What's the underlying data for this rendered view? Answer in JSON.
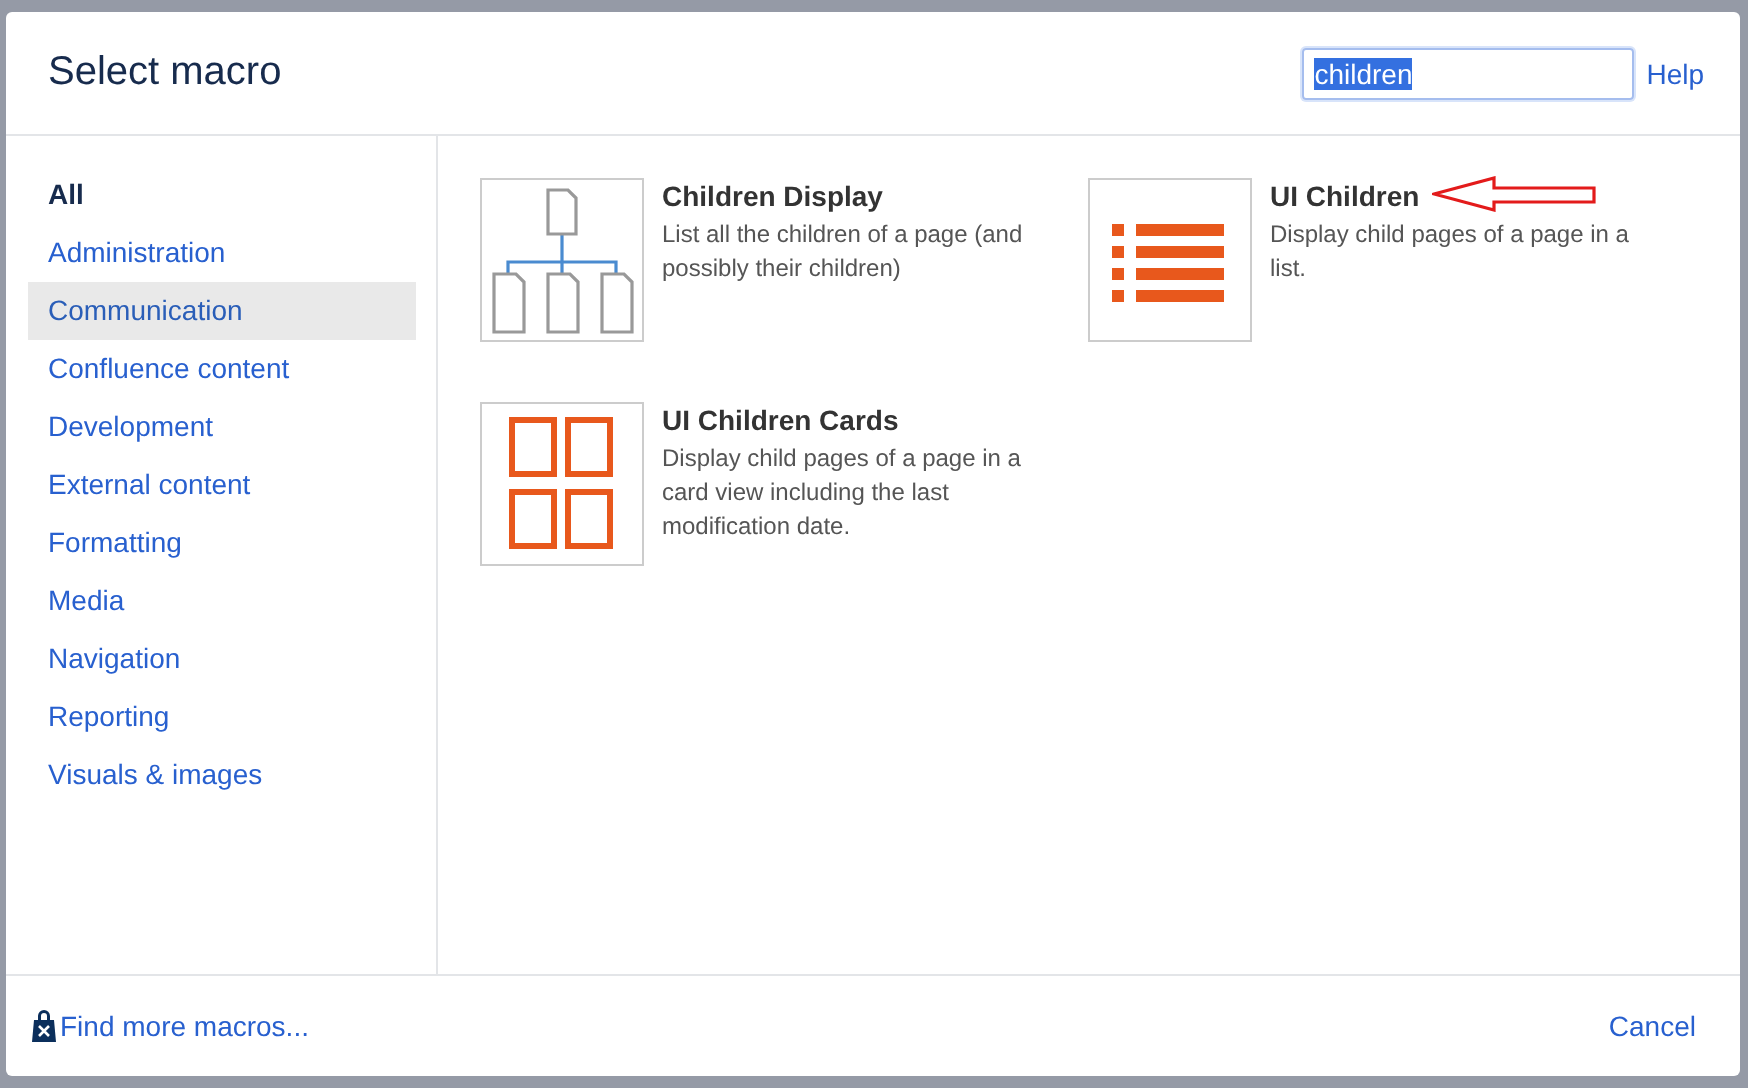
{
  "dialog": {
    "title": "Select macro",
    "search": {
      "value": "children",
      "text_selected": true
    },
    "help_link": "Help"
  },
  "categories": [
    {
      "label": "All",
      "selected": true,
      "highlighted": false
    },
    {
      "label": "Administration",
      "selected": false,
      "highlighted": false
    },
    {
      "label": "Communication",
      "selected": false,
      "highlighted": true
    },
    {
      "label": "Confluence content",
      "selected": false,
      "highlighted": false
    },
    {
      "label": "Development",
      "selected": false,
      "highlighted": false
    },
    {
      "label": "External content",
      "selected": false,
      "highlighted": false
    },
    {
      "label": "Formatting",
      "selected": false,
      "highlighted": false
    },
    {
      "label": "Media",
      "selected": false,
      "highlighted": false
    },
    {
      "label": "Navigation",
      "selected": false,
      "highlighted": false
    },
    {
      "label": "Reporting",
      "selected": false,
      "highlighted": false
    },
    {
      "label": "Visuals & images",
      "selected": false,
      "highlighted": false
    }
  ],
  "macros": [
    {
      "kind": "tree",
      "name": "Children Display",
      "description": "List all the children of a page (and possibly their children)",
      "pointer": false
    },
    {
      "kind": "list",
      "name": "UI Children",
      "description": "Display child pages of a page in a list.",
      "pointer": true
    },
    {
      "kind": "cards",
      "name": "UI Children Cards",
      "description": "Display child pages of a page in a card view including the last modification date.",
      "pointer": false
    }
  ],
  "footer": {
    "find_more": "Find more macros...",
    "cancel": "Cancel"
  }
}
